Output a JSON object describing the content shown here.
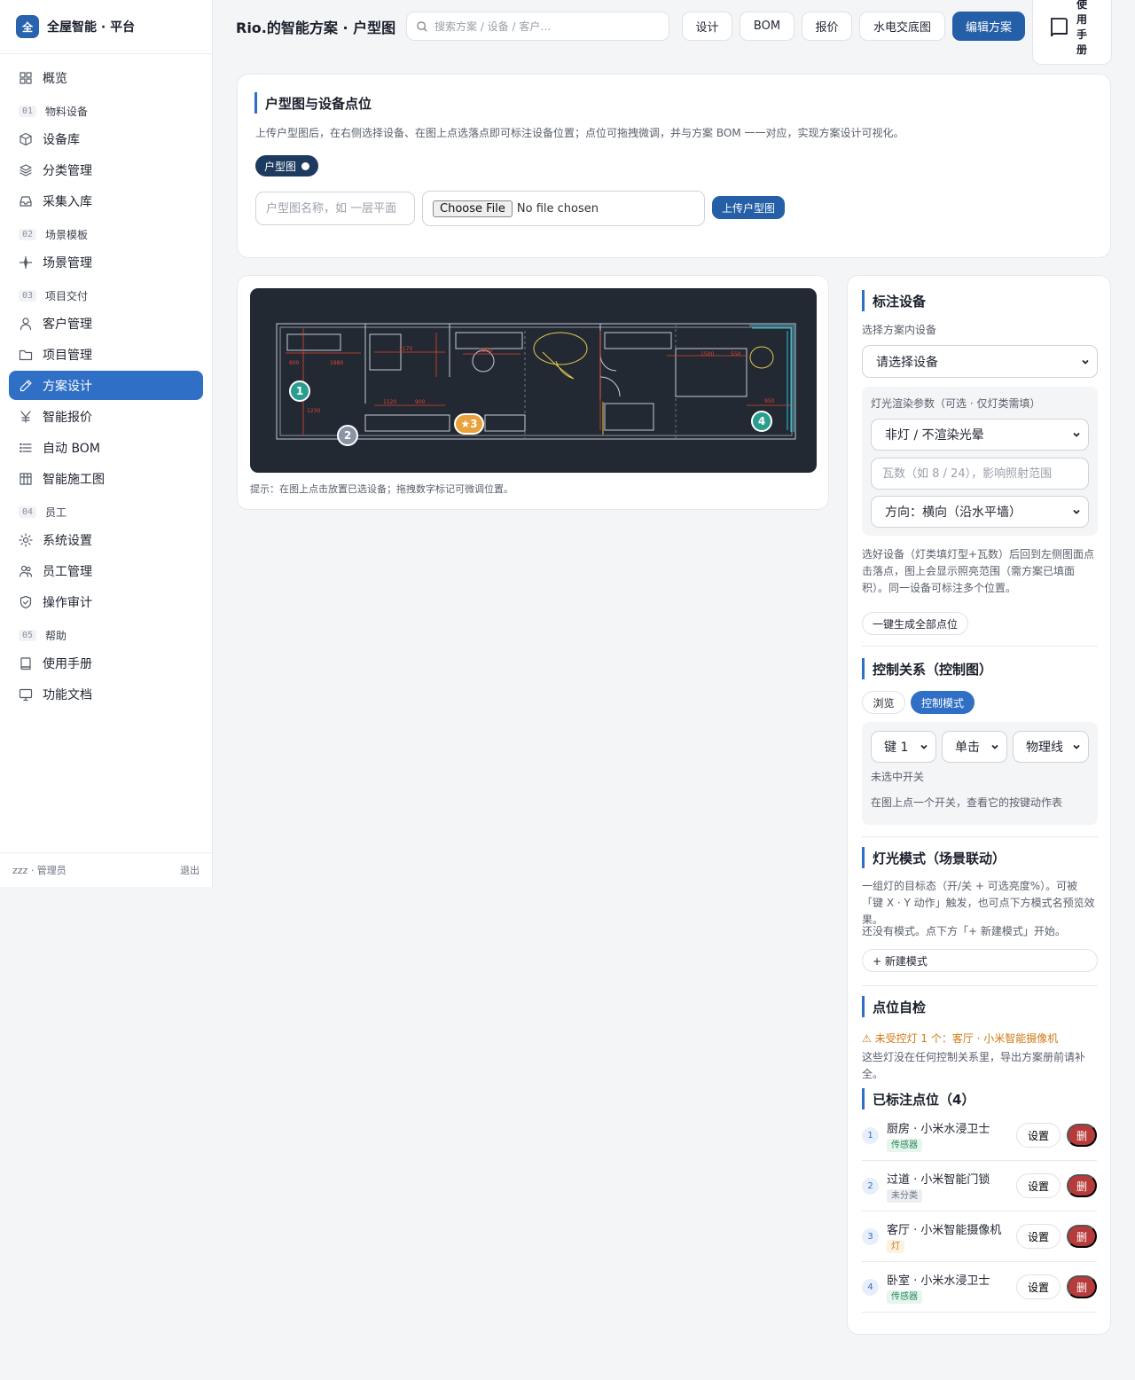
{
  "sidebar": {
    "brand_logo": "全",
    "brand_name": "全屋智能 · 平台",
    "items": [
      {
        "type": "item",
        "label": "概览",
        "icon": "grid-icon",
        "name": "sidebar-item-overview"
      },
      {
        "type": "section",
        "num": "01",
        "label": "物料设备"
      },
      {
        "type": "item",
        "label": "设备库",
        "icon": "cube-icon",
        "name": "sidebar-item-device-library"
      },
      {
        "type": "item",
        "label": "分类管理",
        "icon": "layers-icon",
        "name": "sidebar-item-categories"
      },
      {
        "type": "item",
        "label": "采集入库",
        "icon": "inbox-icon",
        "name": "sidebar-item-collect"
      },
      {
        "type": "section",
        "num": "02",
        "label": "场景模板"
      },
      {
        "type": "item",
        "label": "场景管理",
        "icon": "sparkle-icon",
        "name": "sidebar-item-scenes"
      },
      {
        "type": "section",
        "num": "03",
        "label": "项目交付"
      },
      {
        "type": "item",
        "label": "客户管理",
        "icon": "user-icon",
        "name": "sidebar-item-customers"
      },
      {
        "type": "item",
        "label": "项目管理",
        "icon": "folder-icon",
        "name": "sidebar-item-projects"
      },
      {
        "type": "item",
        "label": "方案设计",
        "icon": "pencil-icon",
        "name": "sidebar-item-design",
        "active": true
      },
      {
        "type": "item",
        "label": "智能报价",
        "icon": "yen-icon",
        "name": "sidebar-item-quote"
      },
      {
        "type": "item",
        "label": "自动 BOM",
        "icon": "list-icon",
        "name": "sidebar-item-bom"
      },
      {
        "type": "item",
        "label": "智能施工图",
        "icon": "table-icon",
        "name": "sidebar-item-construction"
      },
      {
        "type": "section",
        "num": "04",
        "label": "员工"
      },
      {
        "type": "item",
        "label": "系统设置",
        "icon": "sun-gear-icon",
        "name": "sidebar-item-settings"
      },
      {
        "type": "item",
        "label": "员工管理",
        "icon": "users-icon",
        "name": "sidebar-item-staff"
      },
      {
        "type": "item",
        "label": "操作审计",
        "icon": "shield-icon",
        "name": "sidebar-item-audit"
      },
      {
        "type": "section",
        "num": "05",
        "label": "帮助"
      },
      {
        "type": "item",
        "label": "使用手册",
        "icon": "book-icon",
        "name": "sidebar-item-manual"
      },
      {
        "type": "item",
        "label": "功能文档",
        "icon": "monitor-icon",
        "name": "sidebar-item-docs"
      }
    ],
    "user": "zzz · 管理员",
    "logout": "退出"
  },
  "header": {
    "title": "Rio.的智能方案 · 户型图",
    "search_placeholder": "搜索方案 / 设备 / 客户…",
    "tabs": [
      "设计",
      "BOM",
      "报价",
      "水电交底图"
    ],
    "edit_label": "编辑方案",
    "manual_label": "使用手册"
  },
  "upload": {
    "title": "户型图与设备点位",
    "desc": "上传户型图后，在右侧选择设备、在图上点选落点即可标注设备位置；点位可拖拽微调，并与方案 BOM 一一对应，实现方案设计可视化。",
    "tab_label": "户型图",
    "name_placeholder": "户型图名称，如 一层平面",
    "file_button": "Choose File",
    "file_status": "No file chosen",
    "upload_button": "上传户型图"
  },
  "plan": {
    "hint": "提示：在图上点击放置已选设备；拖拽数字标记可微调位置。",
    "markers": [
      {
        "label": "1",
        "color": "#2a9d8f"
      },
      {
        "label": "2",
        "color": "#8a94a6"
      },
      {
        "label": "★3",
        "color": "#e9a23b"
      },
      {
        "label": "4",
        "color": "#2a9d8f"
      }
    ],
    "dims": [
      "600",
      "1980",
      "2170",
      "2200",
      "1120",
      "900",
      "1500",
      "550",
      "950",
      "1230"
    ]
  },
  "annotate": {
    "title": "标注设备",
    "select_label": "选择方案内设备",
    "select_value": "请选择设备",
    "light_title": "灯光渲染参数（可选 · 仅灯类需填）",
    "light_type": "非灯 / 不渲染光晕",
    "watt_placeholder": "瓦数（如 8 / 24），影响照射范围",
    "direction": "方向：横向（沿水平墙）",
    "note": "选好设备（灯类填灯型+瓦数）后回到左侧图面点击落点，图上会显示照亮范围（需方案已填面积）。同一设备可标注多个位置。",
    "gen_button": "一键生成全部点位"
  },
  "control": {
    "title": "控制关系（控制图）",
    "mode_browse": "浏览",
    "mode_control": "控制模式",
    "key": "键 1",
    "click": "单击",
    "wire": "物理线",
    "status": "未选中开关",
    "hint": "在图上点一个开关，查看它的按键动作表"
  },
  "modes": {
    "title": "灯光模式（场景联动）",
    "desc": "一组灯的目标态（开/关 + 可选亮度%）。可被「键 X · Y 动作」触发，也可点下方模式名预览效果。",
    "empty": "还没有模式。点下方「+ 新建模式」开始。",
    "new_button": "+ 新建模式"
  },
  "check": {
    "title": "点位自检",
    "warning": "⚠ 未受控灯 1 个：客厅 · 小米智能摄像机",
    "note": "这些灯没在任何控制关系里，导出方案册前请补全。"
  },
  "points": {
    "title": "已标注点位（4）",
    "set_label": "设置",
    "del_label": "删",
    "items": [
      {
        "num": "1",
        "name": "厨房 · 小米水浸卫士",
        "tag": "传感器",
        "tag_class": "green"
      },
      {
        "num": "2",
        "name": "过道 · 小米智能门锁",
        "tag": "未分类",
        "tag_class": "gray"
      },
      {
        "num": "3",
        "name": "客厅 · 小米智能摄像机",
        "tag": "灯",
        "tag_class": "orange"
      },
      {
        "num": "4",
        "name": "卧室 · 小米水浸卫士",
        "tag": "传感器",
        "tag_class": "green"
      }
    ]
  },
  "colors": {
    "accent": "#2f6fc5",
    "primary_button": "#245fa8",
    "danger": "#b83b3b",
    "plan_bg": "#222933"
  }
}
